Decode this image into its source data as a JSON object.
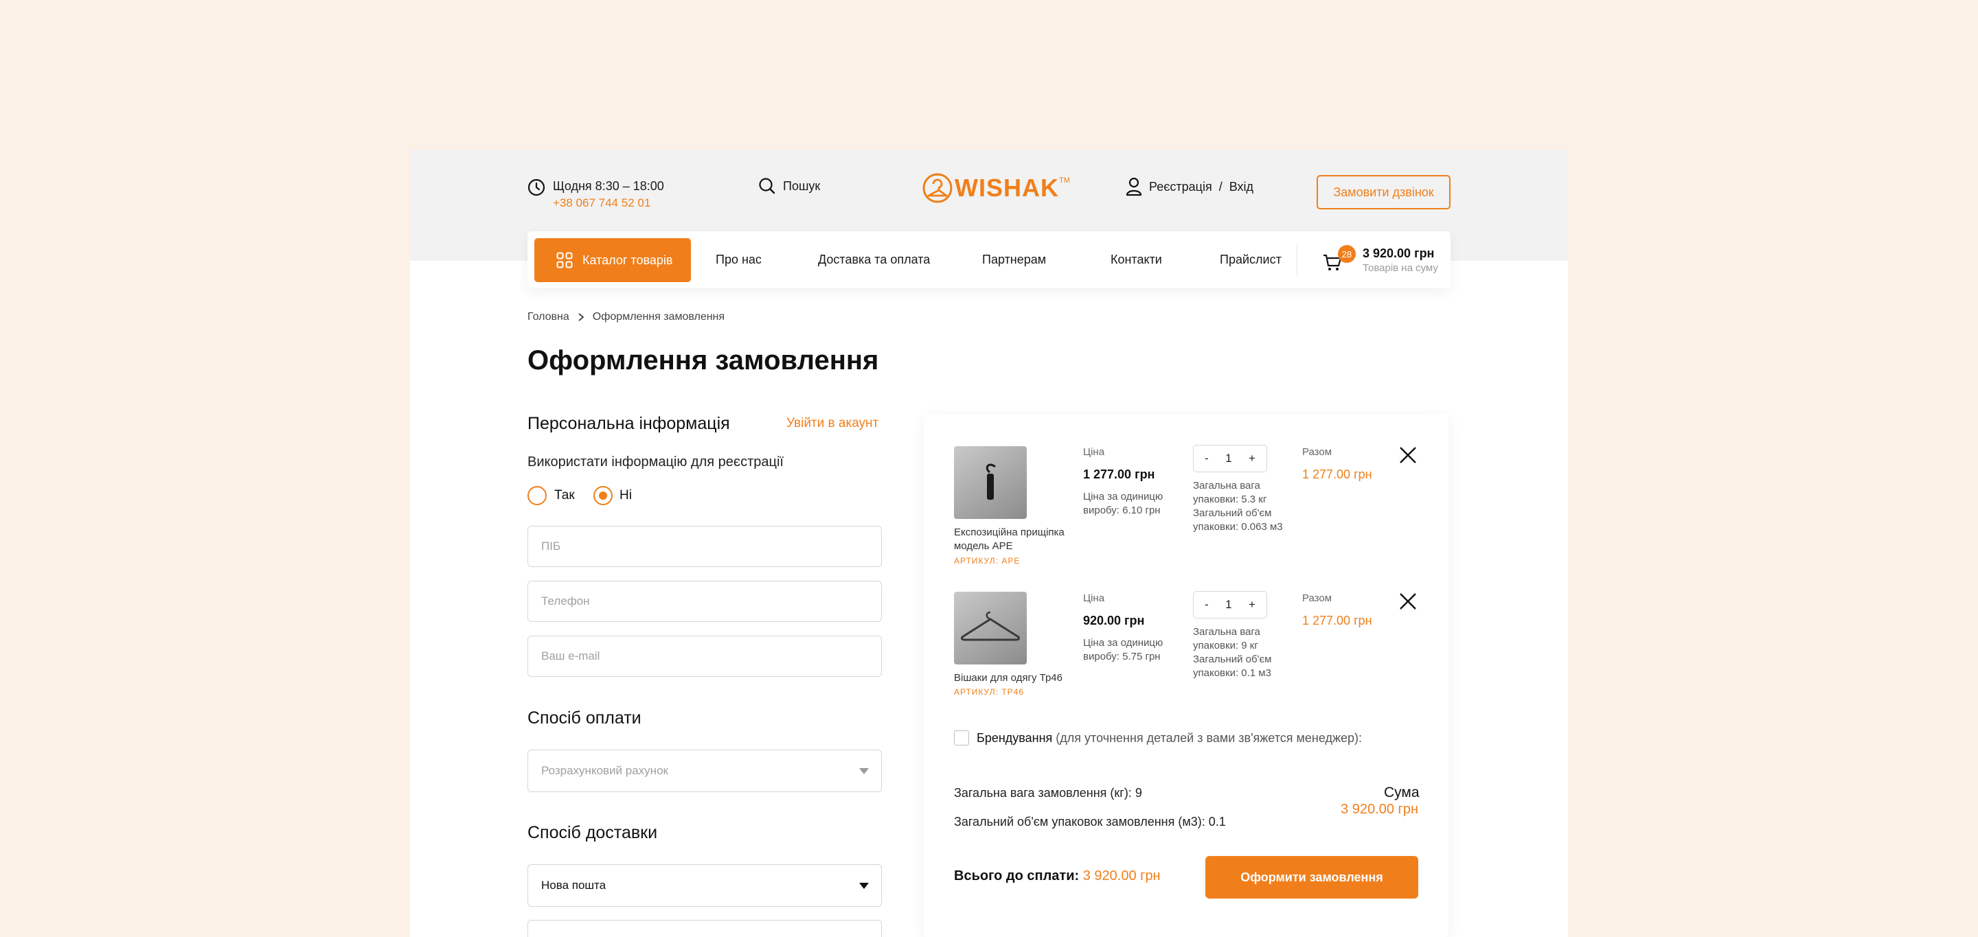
{
  "header": {
    "hours": "Щодня 8:30 – 18:00",
    "phone": "+38 067 744 52 01",
    "search_label": "Пошук",
    "logo_text": "WISHAK",
    "logo_tm": "TM",
    "register_label": "Реєстрація",
    "separator": "/",
    "login_label": "Вхід",
    "call_button": "Замовити дзвінок"
  },
  "nav": {
    "catalog_button": "Каталог товарів",
    "items": [
      "Про нас",
      "Доставка та оплата",
      "Партнерам",
      "Контакти",
      "Прайслист"
    ],
    "cart_count": "28",
    "cart_total": "3 920.00 грн",
    "cart_caption": "Товарів на суму"
  },
  "breadcrumb": {
    "home": "Головна",
    "current": "Оформлення замовлення"
  },
  "page_title": "Оформлення замовлення",
  "personal": {
    "title": "Персональна інформація",
    "login_link": "Увійти в акаунт",
    "register_question": "Використати інформацію для реєстрації",
    "option_yes": "Так",
    "option_no": "Ні",
    "selected": "Ні",
    "fields": {
      "name_placeholder": "ПІБ",
      "phone_placeholder": "Телефон",
      "email_placeholder": "Ваш e-mail"
    }
  },
  "payment": {
    "title": "Спосіб оплати",
    "selected": "Розрахунковий рахунок"
  },
  "delivery": {
    "title": "Спосіб доставки",
    "selected": "Нова пошта"
  },
  "cart": {
    "items": [
      {
        "name_line1": "Експозиційна прищіпка",
        "name_line2": "модель APE",
        "sku": "АРТИКУЛ: APE",
        "price_label": "Ціна",
        "price": "1 277.00 грн",
        "unit_line1": "Ціна за одиницю",
        "unit_line2": "виробу: 6.10 грн",
        "qty": "1",
        "minus": "-",
        "plus": "+",
        "weight_line1": "Загальна вага",
        "weight_line2": "упаковки: 5.3 кг",
        "volume_line1": "Загальний об'єм",
        "volume_line2": "упаковки: 0.063 м3",
        "total_label": "Разом",
        "total": "1 277.00 грн"
      },
      {
        "name_line1": "Вішаки для одягу Тр46",
        "name_line2": "",
        "sku": "АРТИКУЛ: ТР46",
        "price_label": "Ціна",
        "price": "920.00 грн",
        "unit_line1": "Ціна за одиницю",
        "unit_line2": "виробу: 5.75 грн",
        "qty": "1",
        "minus": "-",
        "plus": "+",
        "weight_line1": "Загальна вага",
        "weight_line2": "упаковки: 9 кг",
        "volume_line1": "Загальний об'єм",
        "volume_line2": "упаковки: 0.1 м3",
        "total_label": "Разом",
        "total": "1 277.00 грн"
      }
    ],
    "branding_label": "Брендування",
    "branding_note": "(для уточнення деталей з вами зв'яжется менеджер):",
    "total_weight": "Загальна вага замовлення (кг): 9",
    "total_volume": "Загальний об'єм упаковок замовлення (м3): 0.1",
    "sum_label": "Сума",
    "sum_value": "3 920.00 грн",
    "pay_label": "Всього до сплати:",
    "pay_value": "3 920.00 грн",
    "order_button": "Оформити замовлення"
  },
  "colors": {
    "accent": "#f07f1b",
    "page_bg": "#fcf1e6",
    "header_bg": "#f2f2f2"
  }
}
